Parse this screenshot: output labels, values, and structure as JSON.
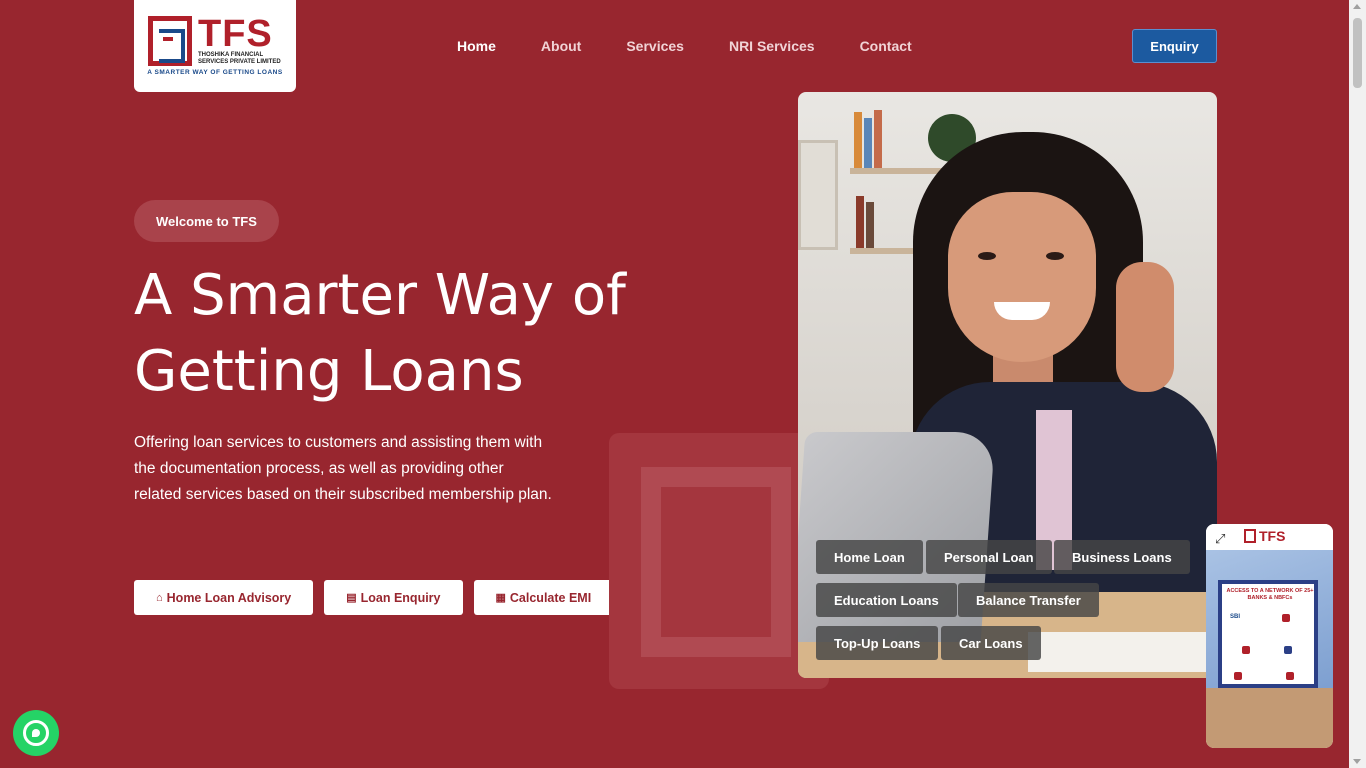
{
  "brand": {
    "name": "TFS",
    "company": "THOSHIKA FINANCIAL SERVICES PRIVATE LIMITED",
    "tagline": "A SMARTER WAY OF GETTING LOANS",
    "colors": {
      "background": "#98262f",
      "primary": "#b0202a",
      "enquiry": "#1c5aa0",
      "whatsapp": "#25d366"
    }
  },
  "nav": {
    "items": [
      {
        "label": "Home",
        "active": true
      },
      {
        "label": "About",
        "active": false
      },
      {
        "label": "Services",
        "active": false
      },
      {
        "label": "NRI Services",
        "active": false
      },
      {
        "label": "Contact",
        "active": false
      }
    ],
    "enquiry_label": "Enquiry"
  },
  "hero": {
    "badge": "Welcome to TFS",
    "headline_line1": "A Smarter Way of",
    "headline_line2": "Getting Loans",
    "description": "Offering loan services to customers and assisting them with the documentation process, as well as providing other related services based on their subscribed membership plan.",
    "ctas": [
      {
        "icon": "home-icon",
        "glyph": "⌂",
        "label": "Home Loan Advisory"
      },
      {
        "icon": "document-icon",
        "glyph": "▤",
        "label": "Loan Enquiry"
      },
      {
        "icon": "calculator-icon",
        "glyph": "▦",
        "label": "Calculate EMI"
      }
    ]
  },
  "loan_tags": [
    "Home Loan",
    "Personal Loan",
    "Business Loans",
    "Education Loans",
    "Balance Transfer",
    "Top-Up Loans",
    "Car Loans"
  ],
  "promo": {
    "logo": "TFS",
    "expand_icon": "expand-icon",
    "card_title": "ACCESS TO A NETWORK OF 25+ BANKS & NBFCs",
    "bank": "SBI"
  },
  "whatsapp": {
    "icon": "whatsapp-icon"
  }
}
